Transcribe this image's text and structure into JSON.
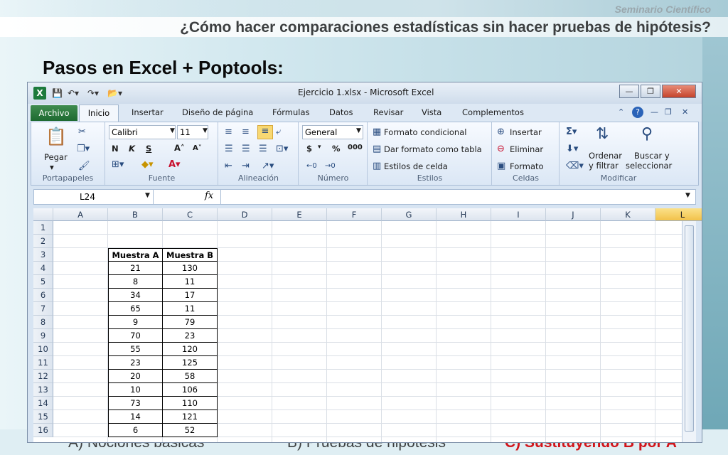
{
  "slide": {
    "brand": "Seminario Científico",
    "subtitle": "¿Cómo hacer comparaciones estadísticas sin hacer pruebas de hipótesis?",
    "title": "Pasos en Excel + Poptools:",
    "nav": [
      "A) Nociones básicas",
      "B) Pruebas de hipótesis",
      "C) Sustituyendo B por A"
    ]
  },
  "window": {
    "title": "Ejercicio 1.xlsx - Microsoft Excel",
    "buttons": {
      "minimize": "—",
      "restore": "❐",
      "close": "✕"
    }
  },
  "tabs": [
    "Archivo",
    "Inicio",
    "Insertar",
    "Diseño de página",
    "Fórmulas",
    "Datos",
    "Revisar",
    "Vista",
    "Complementos"
  ],
  "ribbon": {
    "clipboard": {
      "label": "Portapapeles",
      "paste": "Pegar"
    },
    "font": {
      "label": "Fuente",
      "name": "Calibri",
      "size": "11",
      "bold": "N",
      "italic": "K",
      "underline": "S",
      "grow": "A˄",
      "shrink": "A˅"
    },
    "alignment": {
      "label": "Alineación"
    },
    "number": {
      "label": "Número",
      "format": "General",
      "currency": "$",
      "percent": "%",
      "thousands": "000"
    },
    "styles": {
      "label": "Estilos",
      "conditional": "Formato condicional",
      "table": "Dar formato como tabla",
      "cell": "Estilos de celda"
    },
    "cells": {
      "label": "Celdas",
      "insert": "Insertar",
      "delete": "Eliminar",
      "format": "Formato"
    },
    "editing": {
      "label": "Modificar",
      "sort": "Ordenar",
      "sort2": "y filtrar",
      "find": "Buscar y",
      "find2": "seleccionar"
    }
  },
  "formula_bar": {
    "name_box": "L24",
    "fx": "fx",
    "value": ""
  },
  "sheet": {
    "columns": [
      "A",
      "B",
      "C",
      "D",
      "E",
      "F",
      "G",
      "H",
      "I",
      "J",
      "K",
      "L"
    ],
    "rows": [
      "1",
      "2",
      "3",
      "4",
      "5",
      "6",
      "7",
      "8",
      "9",
      "10",
      "11",
      "12",
      "13",
      "14",
      "15",
      "16"
    ],
    "headers": [
      "Muestra A",
      "Muestra B"
    ],
    "muestra_a": [
      "21",
      "8",
      "34",
      "65",
      "9",
      "70",
      "55",
      "23",
      "20",
      "10",
      "73",
      "14",
      "6"
    ],
    "muestra_b": [
      "130",
      "11",
      "17",
      "11",
      "79",
      "23",
      "120",
      "125",
      "58",
      "106",
      "110",
      "121",
      "52"
    ]
  }
}
